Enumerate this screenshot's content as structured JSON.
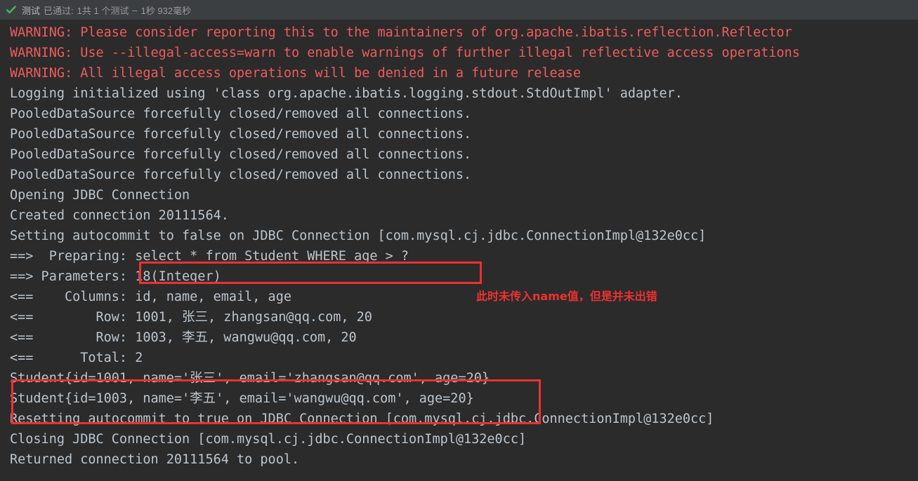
{
  "status_bar": {
    "icon": "check-icon",
    "label": "测试",
    "result": "已通过:",
    "counts": "1共 1 个测试",
    "separator": "–",
    "duration": "1秒 932毫秒",
    "icon_color": "#4caf50"
  },
  "console": {
    "background": "#2b2b2b",
    "warning_color": "#f05b5b",
    "text_color": "#a9b7c6",
    "lines": [
      {
        "text": "WARNING: Please consider reporting this to the maintainers of org.apache.ibatis.reflection.Reflector",
        "type": "warn"
      },
      {
        "text": "WARNING: Use --illegal-access=warn to enable warnings of further illegal reflective access operations",
        "type": "warn"
      },
      {
        "text": "WARNING: All illegal access operations will be denied in a future release",
        "type": "warn"
      },
      {
        "text": "Logging initialized using 'class org.apache.ibatis.logging.stdout.StdOutImpl' adapter.",
        "type": "out"
      },
      {
        "text": "PooledDataSource forcefully closed/removed all connections.",
        "type": "out"
      },
      {
        "text": "PooledDataSource forcefully closed/removed all connections.",
        "type": "out"
      },
      {
        "text": "PooledDataSource forcefully closed/removed all connections.",
        "type": "out"
      },
      {
        "text": "PooledDataSource forcefully closed/removed all connections.",
        "type": "out"
      },
      {
        "text": "Opening JDBC Connection",
        "type": "out"
      },
      {
        "text": "Created connection 20111564.",
        "type": "out"
      },
      {
        "text": "Setting autocommit to false on JDBC Connection [com.mysql.cj.jdbc.ConnectionImpl@132e0cc]",
        "type": "out"
      },
      {
        "text": "==>  Preparing: select * from Student WHERE age > ?",
        "type": "out"
      },
      {
        "text": "==> Parameters: 18(Integer)",
        "type": "out"
      },
      {
        "text": "<==    Columns: id, name, email, age",
        "type": "out"
      },
      {
        "text": "<==        Row: 1001, 张三, zhangsan@qq.com, 20",
        "type": "out"
      },
      {
        "text": "<==        Row: 1003, 李五, wangwu@qq.com, 20",
        "type": "out"
      },
      {
        "text": "<==      Total: 2",
        "type": "out"
      },
      {
        "text": "Student{id=1001, name='张三', email='zhangsan@qq.com', age=20}",
        "type": "out"
      },
      {
        "text": "Student{id=1003, name='李五', email='wangwu@qq.com', age=20}",
        "type": "out"
      },
      {
        "text": "Resetting autocommit to true on JDBC Connection [com.mysql.cj.jdbc.ConnectionImpl@132e0cc]",
        "type": "out"
      },
      {
        "text": "Closing JDBC Connection [com.mysql.cj.jdbc.ConnectionImpl@132e0cc]",
        "type": "out"
      },
      {
        "text": "Returned connection 20111564 to pool.",
        "type": "out"
      }
    ]
  },
  "annotations": {
    "box_color": "#f03030",
    "sql_highlight_text": "select * from Student WHERE age > ?",
    "output_highlight_text": "Student{id=1001, name='张三', email='zhangsan@qq.com', age=20}",
    "note": "此时未传入name值，但是并未出错"
  }
}
